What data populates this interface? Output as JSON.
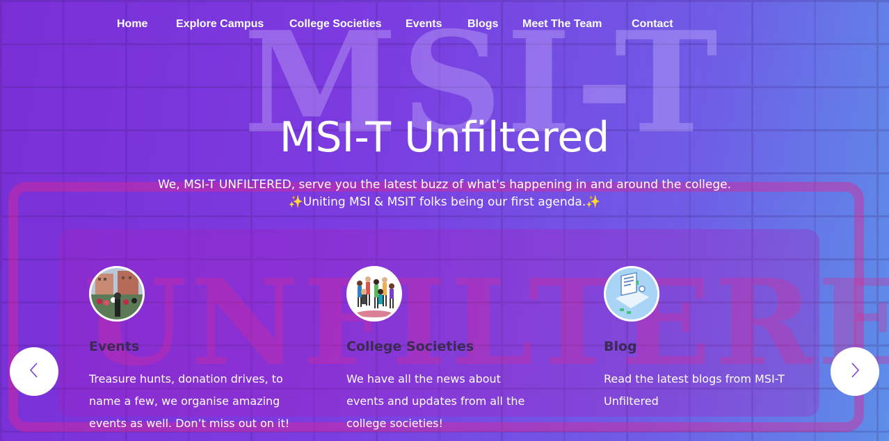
{
  "nav": {
    "items": [
      "Home",
      "Explore Campus",
      "College Societies",
      "Events",
      "Blogs",
      "Meet The Team",
      "Contact"
    ]
  },
  "hero": {
    "watermark_top": "MSI-T",
    "watermark_bottom": "UNFILTERED",
    "title": "MSI-T Unfiltered",
    "subtitle_line1": "We, MSI-T UNFILTERED, serve you the latest buzz of what's happening in and around the college.",
    "subtitle_sparkle": "✨",
    "subtitle_line2": "Uniting MSI & MSIT folks being our first agenda."
  },
  "cards": [
    {
      "title": "Events",
      "text": "Treasure hunts, donation drives, to name a few, we organise amazing events as well. Don’t miss out on it!",
      "icon": "events-photo-icon"
    },
    {
      "title": "College Societies",
      "text": "We have all the news about events and updates from all the college societies!",
      "icon": "crowd-illustration-icon"
    },
    {
      "title": "Blog",
      "text": "Read the latest blogs from MSI-T Unfiltered",
      "icon": "blog-illustration-icon"
    }
  ],
  "carousel": {
    "prev_icon": "chevron-left-icon",
    "next_icon": "chevron-right-icon"
  },
  "colors": {
    "accent": "#7b3ce0",
    "card_title": "#3a2a55",
    "sparkle": "#ffd43b"
  }
}
